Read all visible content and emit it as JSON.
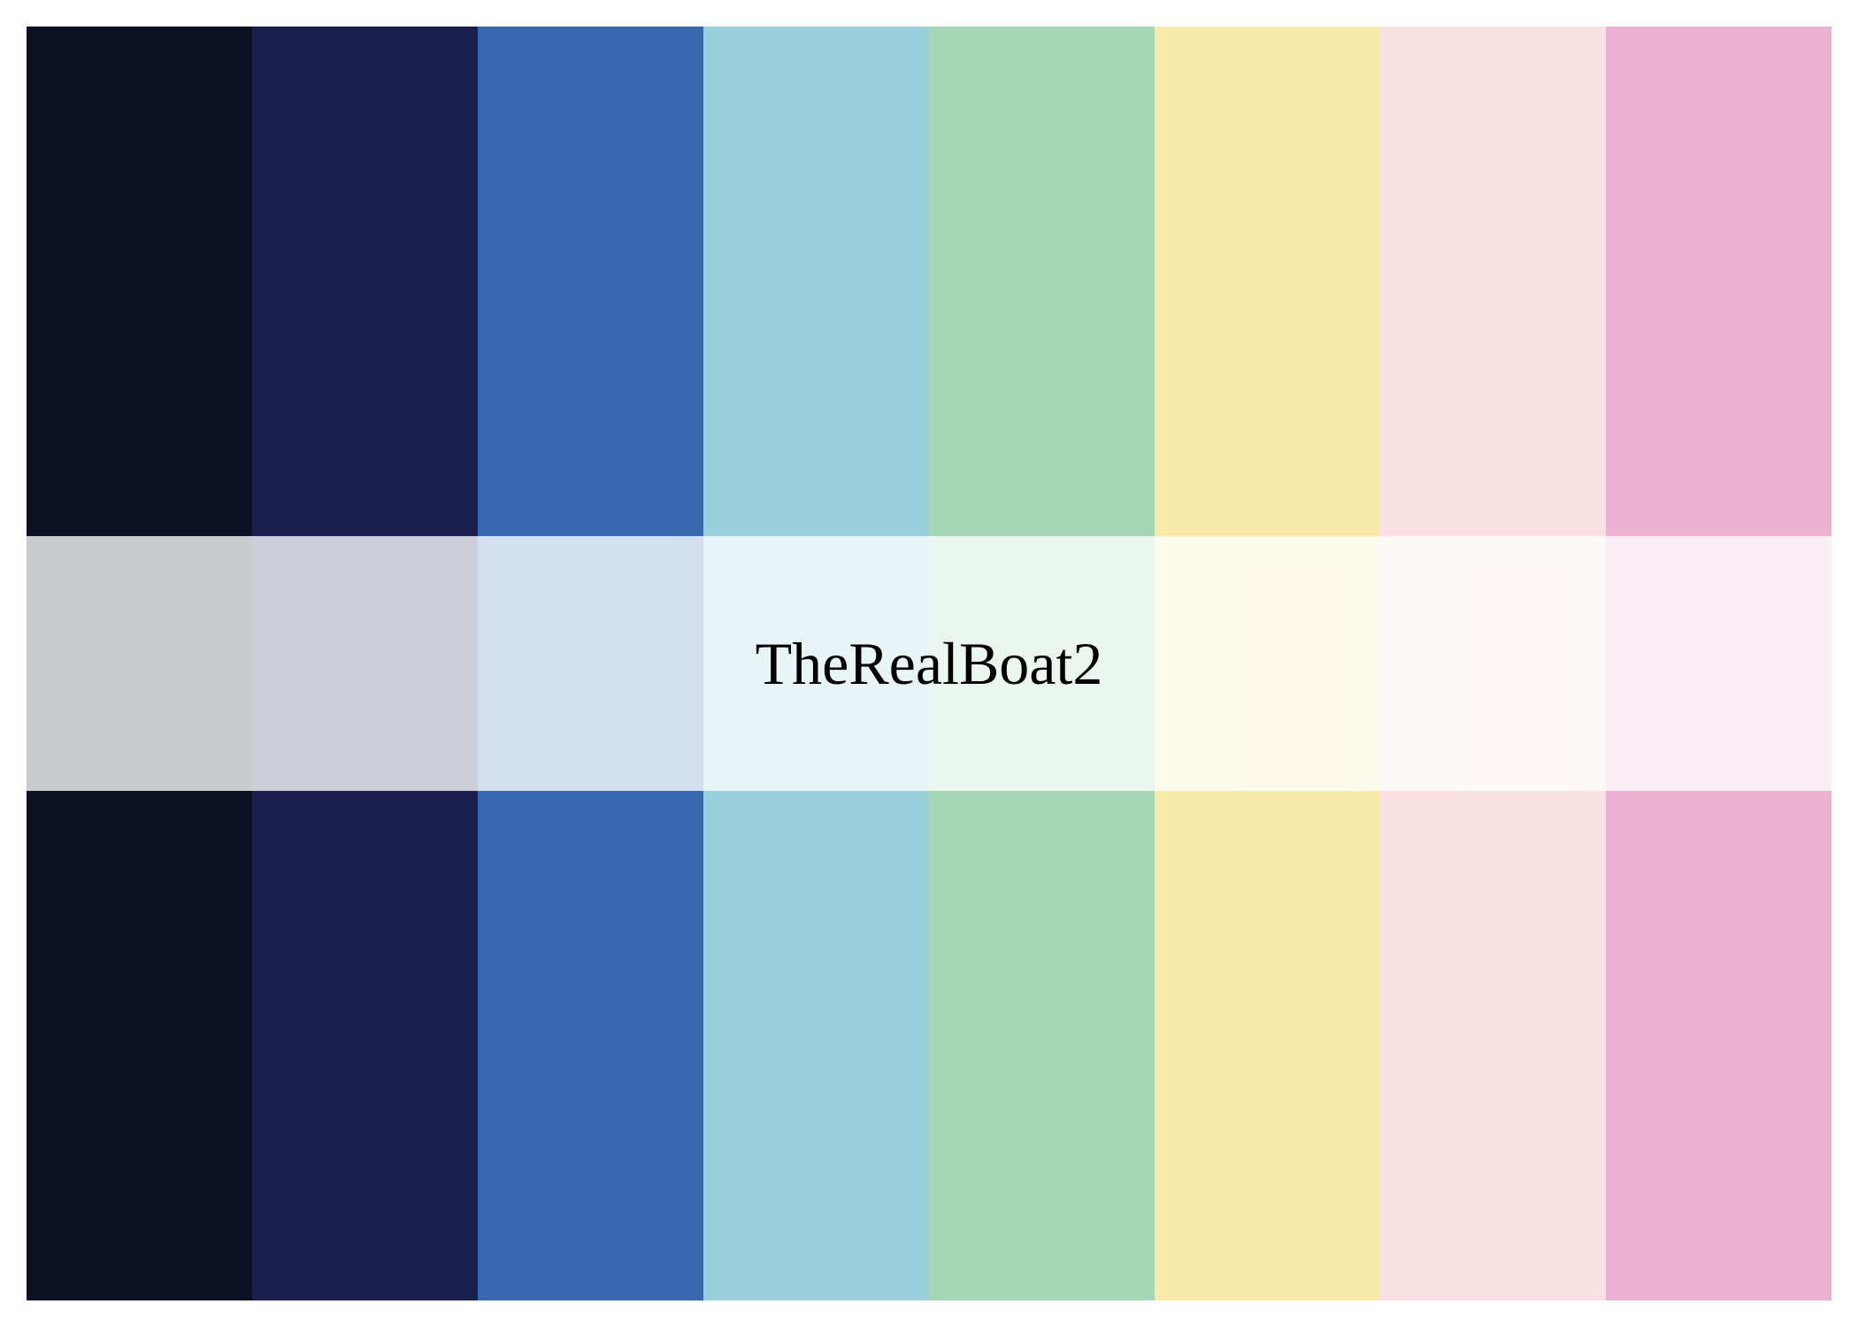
{
  "label": "TheRealBoat2",
  "colors": [
    "#0c1223",
    "#1b1f4d",
    "#3768b0",
    "#9acedb",
    "#a5d6b7",
    "#f7eaab",
    "#fae1e4",
    "#ebb3d1"
  ]
}
